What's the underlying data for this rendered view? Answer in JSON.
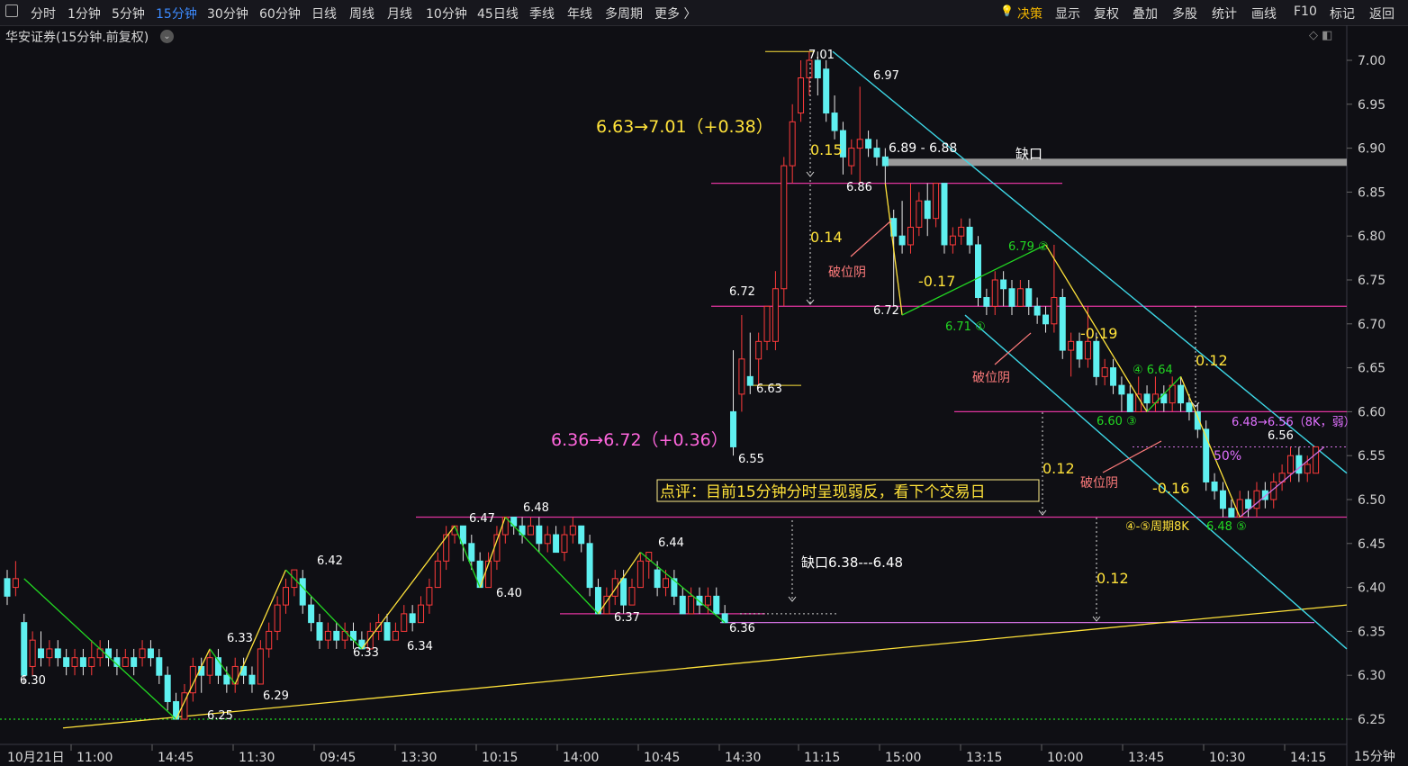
{
  "toolbar": {
    "periods": [
      "分时",
      "1分钟",
      "5分钟",
      "15分钟",
      "30分钟",
      "60分钟",
      "日线",
      "周线",
      "月线",
      "10分钟",
      "45日线",
      "季线",
      "年线",
      "多周期",
      "更多 〉"
    ],
    "active_period": "15分钟",
    "right_items": [
      "决策",
      "显示",
      "复权",
      "叠加",
      "多股",
      "统计",
      "画线",
      "F10",
      "标记",
      "返回"
    ]
  },
  "window_ctrl": "◇ ◧",
  "title": "华安证券(15分钟.前复权)",
  "period_label": "15分钟",
  "colors": {
    "up": "#ff3b3b",
    "down": "#5ff0f0",
    "grid": "#2a2a33",
    "magenta": "#e0349e",
    "yellow": "#ffe23a",
    "green": "#22d822",
    "pink": "#ff8080",
    "channel": "#3dd7e6"
  },
  "chart_data": {
    "type": "candlestick",
    "ylim": [
      6.22,
      7.04
    ],
    "y_ticks": [
      6.25,
      6.3,
      6.35,
      6.4,
      6.45,
      6.5,
      6.55,
      6.6,
      6.65,
      6.7,
      6.75,
      6.8,
      6.85,
      6.9,
      6.95,
      7.0
    ],
    "x_labels": [
      "10月21日",
      "11:00",
      "14:45",
      "11:30",
      "09:45",
      "13:30",
      "10:15",
      "14:00",
      "10:45",
      "14:30",
      "11:15",
      "15:00",
      "13:15",
      "10:00",
      "13:45",
      "10:30",
      "14:15"
    ],
    "candles": [
      [
        6.41,
        6.39,
        6.42,
        6.38
      ],
      [
        6.4,
        6.41,
        6.43,
        6.39
      ],
      [
        6.36,
        6.3,
        6.37,
        6.29
      ],
      [
        6.31,
        6.34,
        6.35,
        6.3
      ],
      [
        6.33,
        6.32,
        6.35,
        6.31
      ],
      [
        6.32,
        6.33,
        6.34,
        6.31
      ],
      [
        6.33,
        6.32,
        6.34,
        6.31
      ],
      [
        6.32,
        6.31,
        6.33,
        6.3
      ],
      [
        6.31,
        6.32,
        6.33,
        6.3
      ],
      [
        6.32,
        6.31,
        6.33,
        6.3
      ],
      [
        6.31,
        6.32,
        6.34,
        6.3
      ],
      [
        6.32,
        6.33,
        6.34,
        6.31
      ],
      [
        6.33,
        6.32,
        6.34,
        6.31
      ],
      [
        6.32,
        6.31,
        6.33,
        6.3
      ],
      [
        6.31,
        6.32,
        6.33,
        6.31
      ],
      [
        6.32,
        6.31,
        6.33,
        6.3
      ],
      [
        6.32,
        6.33,
        6.34,
        6.31
      ],
      [
        6.33,
        6.32,
        6.34,
        6.31
      ],
      [
        6.32,
        6.3,
        6.33,
        6.29
      ],
      [
        6.3,
        6.27,
        6.31,
        6.26
      ],
      [
        6.27,
        6.25,
        6.28,
        6.25
      ],
      [
        6.25,
        6.28,
        6.29,
        6.25
      ],
      [
        6.28,
        6.31,
        6.32,
        6.27
      ],
      [
        6.31,
        6.3,
        6.32,
        6.28
      ],
      [
        6.3,
        6.32,
        6.33,
        6.29
      ],
      [
        6.32,
        6.3,
        6.33,
        6.29
      ],
      [
        6.3,
        6.29,
        6.31,
        6.28
      ],
      [
        6.29,
        6.31,
        6.32,
        6.28
      ],
      [
        6.31,
        6.3,
        6.32,
        6.29
      ],
      [
        6.3,
        6.29,
        6.31,
        6.28
      ],
      [
        6.29,
        6.33,
        6.34,
        6.29
      ],
      [
        6.33,
        6.35,
        6.36,
        6.32
      ],
      [
        6.35,
        6.38,
        6.39,
        6.34
      ],
      [
        6.38,
        6.4,
        6.41,
        6.37
      ],
      [
        6.4,
        6.42,
        6.42,
        6.39
      ],
      [
        6.41,
        6.38,
        6.42,
        6.37
      ],
      [
        6.38,
        6.36,
        6.39,
        6.35
      ],
      [
        6.36,
        6.34,
        6.37,
        6.33
      ],
      [
        6.34,
        6.35,
        6.36,
        6.33
      ],
      [
        6.35,
        6.34,
        6.36,
        6.33
      ],
      [
        6.34,
        6.35,
        6.36,
        6.33
      ],
      [
        6.35,
        6.34,
        6.36,
        6.33
      ],
      [
        6.34,
        6.33,
        6.35,
        6.33
      ],
      [
        6.33,
        6.35,
        6.36,
        6.33
      ],
      [
        6.35,
        6.36,
        6.37,
        6.34
      ],
      [
        6.36,
        6.34,
        6.37,
        6.34
      ],
      [
        6.34,
        6.35,
        6.36,
        6.34
      ],
      [
        6.35,
        6.37,
        6.38,
        6.35
      ],
      [
        6.37,
        6.36,
        6.38,
        6.35
      ],
      [
        6.36,
        6.38,
        6.39,
        6.36
      ],
      [
        6.38,
        6.4,
        6.41,
        6.37
      ],
      [
        6.4,
        6.43,
        6.44,
        6.4
      ],
      [
        6.43,
        6.46,
        6.47,
        6.42
      ],
      [
        6.46,
        6.47,
        6.47,
        6.45
      ],
      [
        6.47,
        6.45,
        6.47,
        6.43
      ],
      [
        6.45,
        6.43,
        6.46,
        6.42
      ],
      [
        6.43,
        6.4,
        6.44,
        6.4
      ],
      [
        6.4,
        6.43,
        6.44,
        6.4
      ],
      [
        6.43,
        6.46,
        6.47,
        6.42
      ],
      [
        6.46,
        6.48,
        6.48,
        6.45
      ],
      [
        6.48,
        6.47,
        6.48,
        6.46
      ],
      [
        6.47,
        6.46,
        6.48,
        6.45
      ],
      [
        6.46,
        6.47,
        6.48,
        6.46
      ],
      [
        6.47,
        6.45,
        6.48,
        6.44
      ],
      [
        6.45,
        6.46,
        6.47,
        6.44
      ],
      [
        6.46,
        6.44,
        6.47,
        6.44
      ],
      [
        6.44,
        6.46,
        6.47,
        6.43
      ],
      [
        6.46,
        6.47,
        6.48,
        6.45
      ],
      [
        6.47,
        6.45,
        6.47,
        6.44
      ],
      [
        6.45,
        6.4,
        6.46,
        6.39
      ],
      [
        6.4,
        6.37,
        6.41,
        6.37
      ],
      [
        6.37,
        6.39,
        6.4,
        6.37
      ],
      [
        6.39,
        6.41,
        6.42,
        6.38
      ],
      [
        6.41,
        6.38,
        6.42,
        6.37
      ],
      [
        6.38,
        6.4,
        6.41,
        6.38
      ],
      [
        6.4,
        6.43,
        6.44,
        6.4
      ],
      [
        6.43,
        6.44,
        6.44,
        6.41
      ],
      [
        6.42,
        6.4,
        6.43,
        6.39
      ],
      [
        6.4,
        6.41,
        6.42,
        6.39
      ],
      [
        6.41,
        6.39,
        6.42,
        6.38
      ],
      [
        6.39,
        6.37,
        6.4,
        6.37
      ],
      [
        6.37,
        6.39,
        6.4,
        6.37
      ],
      [
        6.39,
        6.38,
        6.4,
        6.37
      ],
      [
        6.38,
        6.39,
        6.4,
        6.37
      ],
      [
        6.39,
        6.37,
        6.4,
        6.37
      ],
      [
        6.37,
        6.36,
        6.38,
        6.36
      ],
      [
        6.6,
        6.56,
        6.67,
        6.55
      ],
      [
        6.62,
        6.66,
        6.71,
        6.6
      ],
      [
        6.64,
        6.63,
        6.69,
        6.62
      ],
      [
        6.66,
        6.68,
        6.69,
        6.63
      ],
      [
        6.68,
        6.72,
        6.72,
        6.67
      ],
      [
        6.68,
        6.74,
        6.76,
        6.67
      ],
      [
        6.74,
        6.88,
        6.89,
        6.72
      ],
      [
        6.88,
        6.93,
        6.95,
        6.86
      ],
      [
        6.94,
        6.98,
        7.0,
        6.93
      ],
      [
        6.98,
        7.0,
        7.01,
        6.96
      ],
      [
        7.0,
        6.98,
        7.01,
        6.96
      ],
      [
        6.99,
        6.94,
        7.0,
        6.93
      ],
      [
        6.94,
        6.92,
        6.96,
        6.91
      ],
      [
        6.92,
        6.89,
        6.93,
        6.87
      ],
      [
        6.88,
        6.9,
        6.91,
        6.87
      ],
      [
        6.9,
        6.91,
        6.97,
        6.86
      ],
      [
        6.91,
        6.9,
        6.92,
        6.89
      ],
      [
        6.9,
        6.89,
        6.91,
        6.88
      ],
      [
        6.89,
        6.88,
        6.9,
        6.86
      ],
      [
        6.82,
        6.8,
        6.83,
        6.72
      ],
      [
        6.8,
        6.79,
        6.84,
        6.78
      ],
      [
        6.79,
        6.81,
        6.86,
        6.78
      ],
      [
        6.81,
        6.84,
        6.85,
        6.8
      ],
      [
        6.84,
        6.82,
        6.86,
        6.8
      ],
      [
        6.82,
        6.86,
        6.86,
        6.81
      ],
      [
        6.86,
        6.79,
        6.86,
        6.78
      ],
      [
        6.79,
        6.8,
        6.81,
        6.78
      ],
      [
        6.8,
        6.81,
        6.82,
        6.79
      ],
      [
        6.81,
        6.79,
        6.82,
        6.78
      ],
      [
        6.79,
        6.73,
        6.8,
        6.72
      ],
      [
        6.73,
        6.72,
        6.74,
        6.71
      ],
      [
        6.72,
        6.75,
        6.76,
        6.71
      ],
      [
        6.75,
        6.74,
        6.76,
        6.72
      ],
      [
        6.74,
        6.72,
        6.75,
        6.71
      ],
      [
        6.72,
        6.74,
        6.75,
        6.72
      ],
      [
        6.74,
        6.72,
        6.75,
        6.71
      ],
      [
        6.72,
        6.71,
        6.73,
        6.7
      ],
      [
        6.71,
        6.7,
        6.72,
        6.69
      ],
      [
        6.7,
        6.73,
        6.79,
        6.69
      ],
      [
        6.73,
        6.67,
        6.74,
        6.66
      ],
      [
        6.67,
        6.68,
        6.69,
        6.64
      ],
      [
        6.68,
        6.66,
        6.69,
        6.65
      ],
      [
        6.66,
        6.68,
        6.72,
        6.65
      ],
      [
        6.68,
        6.64,
        6.69,
        6.63
      ],
      [
        6.64,
        6.65,
        6.66,
        6.63
      ],
      [
        6.65,
        6.63,
        6.66,
        6.62
      ],
      [
        6.63,
        6.62,
        6.64,
        6.6
      ],
      [
        6.62,
        6.6,
        6.63,
        6.6
      ],
      [
        6.6,
        6.62,
        6.64,
        6.6
      ],
      [
        6.62,
        6.61,
        6.63,
        6.6
      ],
      [
        6.61,
        6.62,
        6.64,
        6.6
      ],
      [
        6.62,
        6.61,
        6.63,
        6.6
      ],
      [
        6.61,
        6.63,
        6.64,
        6.6
      ],
      [
        6.63,
        6.61,
        6.64,
        6.6
      ],
      [
        6.61,
        6.6,
        6.62,
        6.59
      ],
      [
        6.6,
        6.58,
        6.61,
        6.57
      ],
      [
        6.58,
        6.52,
        6.59,
        6.51
      ],
      [
        6.52,
        6.51,
        6.53,
        6.5
      ],
      [
        6.51,
        6.49,
        6.52,
        6.48
      ],
      [
        6.49,
        6.48,
        6.5,
        6.48
      ],
      [
        6.48,
        6.5,
        6.51,
        6.48
      ],
      [
        6.5,
        6.49,
        6.51,
        6.48
      ],
      [
        6.49,
        6.51,
        6.52,
        6.48
      ],
      [
        6.51,
        6.5,
        6.52,
        6.49
      ],
      [
        6.5,
        6.52,
        6.53,
        6.49
      ],
      [
        6.52,
        6.53,
        6.54,
        6.51
      ],
      [
        6.53,
        6.55,
        6.56,
        6.52
      ],
      [
        6.55,
        6.53,
        6.56,
        6.52
      ],
      [
        6.53,
        6.54,
        6.55,
        6.52
      ],
      [
        6.53,
        6.56,
        6.56,
        6.53
      ]
    ],
    "pivots": [
      {
        "i": 2,
        "v": 6.3,
        "label": "6.30"
      },
      {
        "i": 20,
        "v": 6.25,
        "label": "6.25"
      },
      {
        "i": 24,
        "v": 6.33,
        "label": "6.33"
      },
      {
        "i": 27,
        "v": 6.29,
        "label": "6.29"
      },
      {
        "i": 33,
        "v": 6.42,
        "label": "6.42"
      },
      {
        "i": 42,
        "v": 6.33,
        "label": "6.33"
      },
      {
        "i": 46,
        "v": 6.34,
        "label": "6.34"
      },
      {
        "i": 53,
        "v": 6.47,
        "label": "6.47"
      },
      {
        "i": 56,
        "v": 6.4,
        "label": "6.40"
      },
      {
        "i": 59,
        "v": 6.48,
        "label": "6.48"
      },
      {
        "i": 70,
        "v": 6.37,
        "label": "6.37"
      },
      {
        "i": 75,
        "v": 6.44,
        "label": "6.44"
      },
      {
        "i": 85,
        "v": 6.36,
        "label": "6.36"
      },
      {
        "i": 86,
        "v": 6.55,
        "label": "6.55"
      },
      {
        "i": 88,
        "v": 6.63,
        "label": "6.63"
      },
      {
        "i": 95,
        "v": 7.01,
        "label": "7.01"
      },
      {
        "i": 101,
        "v": 6.97,
        "label": "6.97"
      },
      {
        "i": 99,
        "v": 6.86,
        "label": "6.86"
      },
      {
        "i": 103,
        "v": 6.72,
        "label": "6.72"
      },
      {
        "i": 90,
        "v": 6.72,
        "label": "6.72"
      }
    ],
    "texts": [
      {
        "text": "6.63→7.01（+0.38）",
        "color": "yellow"
      },
      {
        "text": "6.36→6.72（+0.36）",
        "color": "magenta"
      },
      {
        "text": "点评：目前15分钟分时呈现弱反，看下个交易日",
        "color": "yellow"
      },
      {
        "text": "缺口6.38---6.48",
        "color": "white"
      },
      {
        "text": "缺口",
        "color": "white"
      },
      {
        "text": "6.89 - 6.88",
        "color": "white"
      },
      {
        "text": "0.15",
        "color": "yellow"
      },
      {
        "text": "0.14",
        "color": "yellow"
      },
      {
        "text": "-0.17",
        "color": "yellow"
      },
      {
        "text": "-0.19",
        "color": "yellow"
      },
      {
        "text": "-0.16",
        "color": "yellow"
      },
      {
        "text": "0.12",
        "color": "yellow"
      },
      {
        "text": "0.12",
        "color": "yellow"
      },
      {
        "text": "0.12",
        "color": "yellow"
      },
      {
        "text": "破位阴",
        "color": "pink"
      },
      {
        "text": "破位阴",
        "color": "pink"
      },
      {
        "text": "破位阴",
        "color": "pink"
      },
      {
        "text": "6.71 ①",
        "color": "green"
      },
      {
        "text": "6.79 ②",
        "color": "green"
      },
      {
        "text": "6.60 ③",
        "color": "green"
      },
      {
        "text": "④ 6.64",
        "color": "green"
      },
      {
        "text": "6.48 ⑤",
        "color": "green"
      },
      {
        "text": "④-⑤周期8K",
        "color": "yellow"
      },
      {
        "text": "6.48→6.56（8K，弱）",
        "color": "violet"
      },
      {
        "text": "50%",
        "color": "violet"
      },
      {
        "text": "6.56",
        "color": "white"
      }
    ]
  }
}
